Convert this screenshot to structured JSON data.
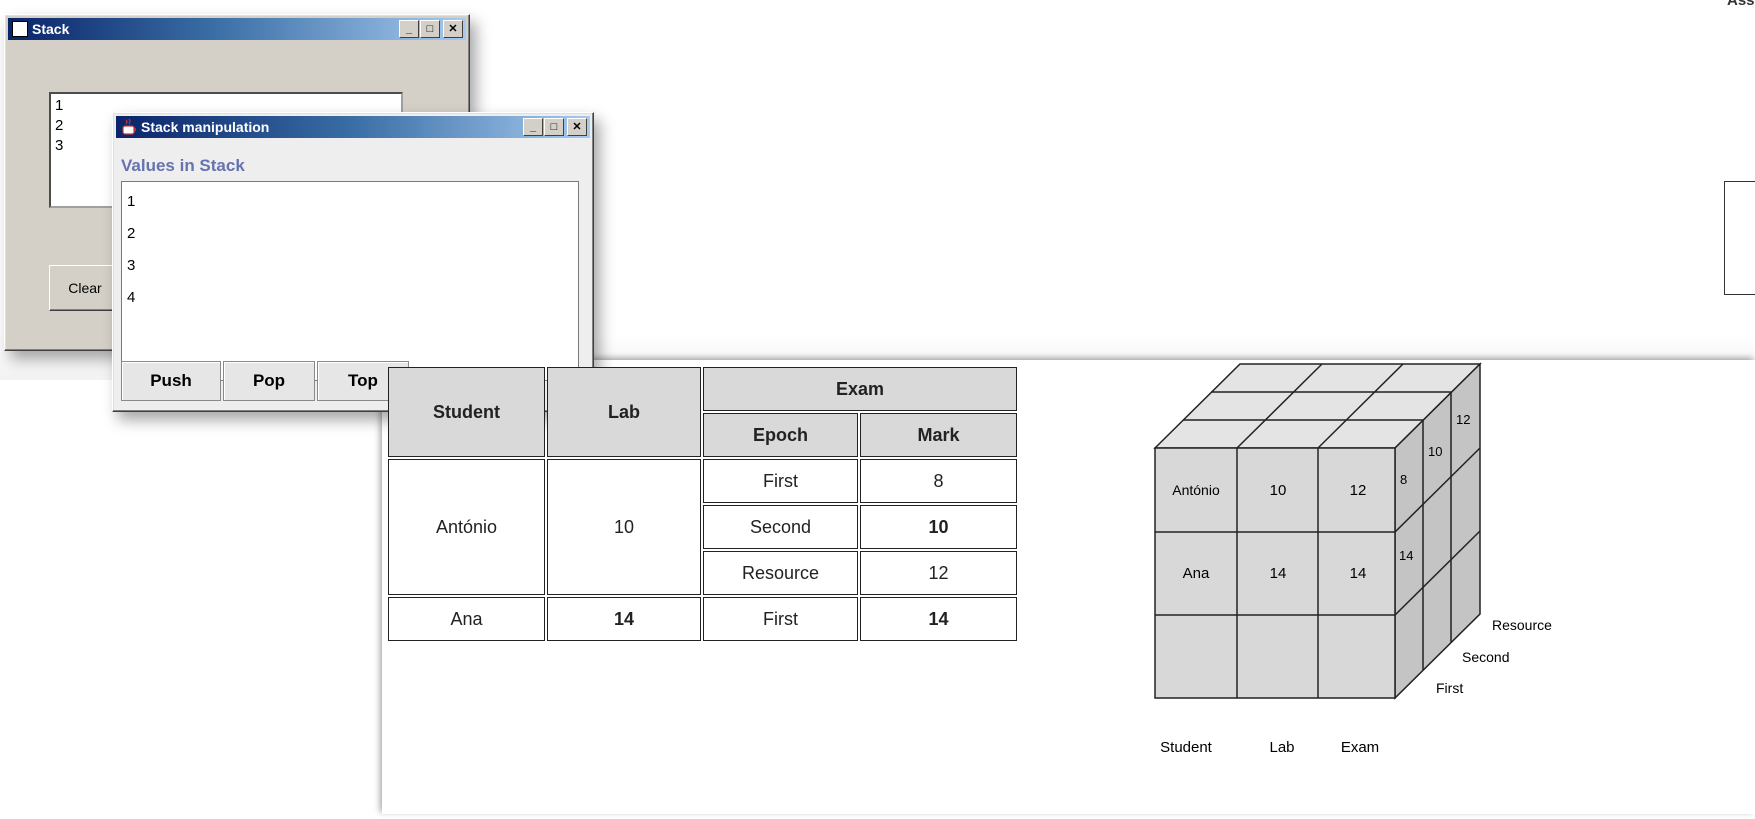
{
  "page": {
    "corner_text": "Ass"
  },
  "stack_window": {
    "title": "Stack",
    "list_items": [
      "1",
      "2",
      "3"
    ],
    "clear_button": "Clear"
  },
  "manip_window": {
    "title": "Stack manipulation",
    "values_label": "Values in Stack",
    "list_items": [
      "1",
      "2",
      "3",
      "4"
    ],
    "buttons": [
      "Push",
      "Pop",
      "Top"
    ]
  },
  "title_buttons": {
    "minimize": "_",
    "maximize": "□",
    "close": "✕"
  },
  "table": {
    "headers": {
      "student": "Student",
      "lab": "Lab",
      "exam": "Exam",
      "epoch": "Epoch",
      "mark": "Mark"
    },
    "rows": [
      {
        "student": "António",
        "lab": "10",
        "epochs": [
          {
            "epoch": "First",
            "mark": "8"
          },
          {
            "epoch": "Second",
            "mark": "10"
          },
          {
            "epoch": "Resource",
            "mark": "12"
          }
        ]
      },
      {
        "student": "Ana",
        "lab": "14",
        "epochs": [
          {
            "epoch": "First",
            "mark": "14"
          }
        ]
      }
    ]
  },
  "cube": {
    "front_rows": [
      [
        "António",
        "10",
        "12"
      ],
      [
        "Ana",
        "14",
        "14"
      ],
      [
        "",
        "",
        ""
      ]
    ],
    "side_values": [
      "8",
      "10",
      "12",
      "14"
    ],
    "bottom_labels": [
      "Student",
      "Lab",
      "Exam"
    ],
    "depth_labels": [
      "First",
      "Second",
      "Resource"
    ]
  }
}
